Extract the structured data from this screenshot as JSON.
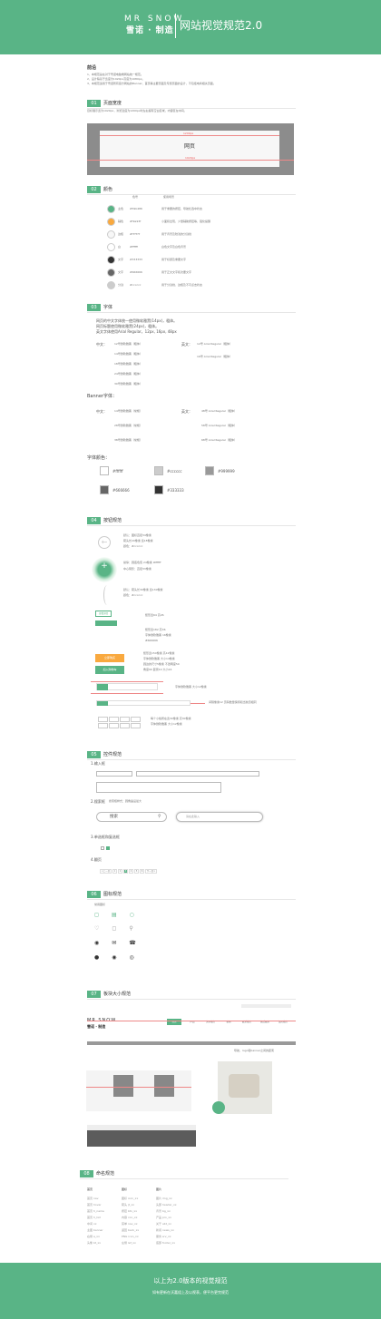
{
  "header": {
    "logo_en": "MR SNOW",
    "logo_cn": "雪诺 · 制造",
    "title": "网站视觉规范2.0"
  },
  "preface": {
    "title": "前沿",
    "items": [
      "1、本规范旨在对于雪诺电脑端网站统一规范。",
      "2、设计稿基于宽度为1920px高度为1080px。",
      "3、本规范适用于雪诺所有官方网站的Banner、首页等主要页面及专题页面的设计，不包括电商相关页面。"
    ]
  },
  "s1": {
    "num": "01",
    "name": "页面宽度",
    "desc": "目标展示宽为1920px，浏览宽度为1200px时左右留有空白区域，内容区在中间。",
    "w1": "1200px",
    "w2": "1920px",
    "page": "网页"
  },
  "s2": {
    "num": "02",
    "name": "颜色",
    "h_value": "色号",
    "h_usage": "使用场景",
    "colors": [
      {
        "name": "主色",
        "hex": "#59b486",
        "usage": "用于重要的按钮、导航栏选中状态",
        "c": "#59b486"
      },
      {
        "name": "辅色",
        "hex": "#f9a93f",
        "usage": "小面积出现，少量辅助按钮等，强化提醒",
        "c": "#f9a93f"
      },
      {
        "name": "边框",
        "hex": "#f7f7f7",
        "usage": "用于背景及较浅的分割线",
        "c": "#f7f7f7"
      },
      {
        "name": "白",
        "hex": "#ffffff",
        "usage": "白色文字及白色背景",
        "c": "#ffffff"
      },
      {
        "name": "文字",
        "hex": "#333333",
        "usage": "用于标题及重要文字",
        "c": "#333333"
      },
      {
        "name": "文字",
        "hex": "#666666",
        "usage": "用于正文文字和次要文字",
        "c": "#666666"
      },
      {
        "name": "分割",
        "hex": "#cccccc",
        "usage": "用于分割线、边框及不可点击状态",
        "c": "#cccccc"
      }
    ]
  },
  "s3": {
    "num": "03",
    "name": "字体",
    "intro": [
      "网页的中文字体统一使用微软雅黑(14px)，粗体。",
      "网页标题使用微软雅黑(24px)，粗体。",
      "英文字体使用Arial Regular，12px, 16px, 48px"
    ],
    "cn_label": "中文：",
    "en_label": "英文：",
    "cn": [
      "12号微软雅黑（粗体）",
      "14号微软雅黑（粗体）",
      "18号微软雅黑（粗体）",
      "24号微软雅黑（粗体）",
      "30号微软雅黑（粗体）"
    ],
    "en": [
      "12号 Arial Regular（粗体）",
      "16号 Arial Regular（粗体）"
    ],
    "banner_title": "Banner字体：",
    "banner_cn": [
      "14号微软雅黑（常规）",
      "28号微软雅黑（常规）",
      "38号微软雅黑（常规）"
    ],
    "banner_en": [
      "48号 Arial Regular（粗体）",
      "58号 Arial Regular（粗体）",
      "68号 Arial Regular（粗体）"
    ],
    "fc_title": "字体颜色：",
    "font_colors": [
      {
        "hex": "#ffffff",
        "c": "#ffffff"
      },
      {
        "hex": "#cccccc",
        "c": "#cccccc"
      },
      {
        "hex": "#999999",
        "c": "#999999"
      },
      {
        "hex": "#666666",
        "c": "#666666"
      },
      {
        "hex": "#333333",
        "c": "#333333"
      }
    ]
  },
  "s4": {
    "num": "04",
    "name": "按钮规范",
    "b1": [
      "默认：图标直径34像素",
      "         箭头长20像素 宽18像素",
      "颜色：#cccccc"
    ],
    "b2": [
      "悬停：圆底色值 24像素  #ffffff",
      "中心阴影：直径33像素"
    ],
    "b3": [
      "默认：箭头长30像素 宽130像素",
      "颜色：#cccccc"
    ],
    "b4": "矩形宽64 高26",
    "b4_label": "查看详情",
    "b5": [
      "矩形宽182 高36",
      "字体微软雅黑 16像素",
      "#666666"
    ],
    "b6": [
      "矩形宽150像素 高42像素",
      "字体微软雅黑 大小14像素",
      "圆边的尺寸5像素 不透明度50",
      "角度90 距离10 大小24"
    ],
    "b6_btn1": "立即购买",
    "b6_btn2": "加入购物车",
    "page_note": "字体微软雅黑 大小12像素",
    "search_note": "间隔像素12 页码数量保持和当前页相同",
    "sizes_note": [
      "每个小格所在宽30像素 高30像素",
      "字体微软雅黑 大小12像素"
    ]
  },
  "s5": {
    "num": "05",
    "name": "控件规范",
    "input_title": "1.输入框",
    "search_title": "2.搜索框",
    "search_desc": "搜索框样式：圆角遍设最大",
    "search_ph": "搜索",
    "search_ph2": "请在此输入",
    "check_title": "3.单选框和复选框",
    "page_title": "4.翻页",
    "pager": [
      "<上一页",
      "1",
      "2",
      "3",
      "4",
      "5",
      "6",
      "下一页>"
    ]
  },
  "s6": {
    "num": "06",
    "name": "图标规范",
    "label": "常用图标"
  },
  "s7": {
    "num": "07",
    "name": "板块大小规范",
    "nav_note": "导航，logo和banner之间的距离",
    "nav_items": [
      "首页",
      "产品",
      "关于我们",
      "新闻",
      "联系我们",
      "售后服务",
      "加入我们"
    ]
  },
  "s8": {
    "num": "08",
    "name": "命名规范",
    "cols": [
      "首页",
      "图标",
      "图片"
    ],
    "c1": [
      "首页 nav",
      "首页 hover",
      "首页 h_name",
      "首页 h_list",
      "中间 xx",
      "主图 banner",
      "右侧 a_xx",
      "头像 bt_xx"
    ],
    "c2": [
      "图标 icon_xx",
      "箭头 jt_xx",
      "按钮 btn_xx",
      "内容 con_xx",
      "菜单 nav_xx",
      "返回 back_xx",
      "PNG icon_xx",
      "左侧 lef_xx"
    ],
    "c3": [
      "图片 img_xx",
      "头部 header_xx",
      "背景 bg_xx",
      "产品 pro_xx",
      "关于 abt_xx",
      "新闻 news_xx",
      "服务 srv_xx",
      "底部 footer_xx"
    ]
  },
  "footer": {
    "l1": "以上为2.0版本的视觉规范",
    "l2": "如有更新在沃嘉组上及以视表，便平台更完规范"
  }
}
